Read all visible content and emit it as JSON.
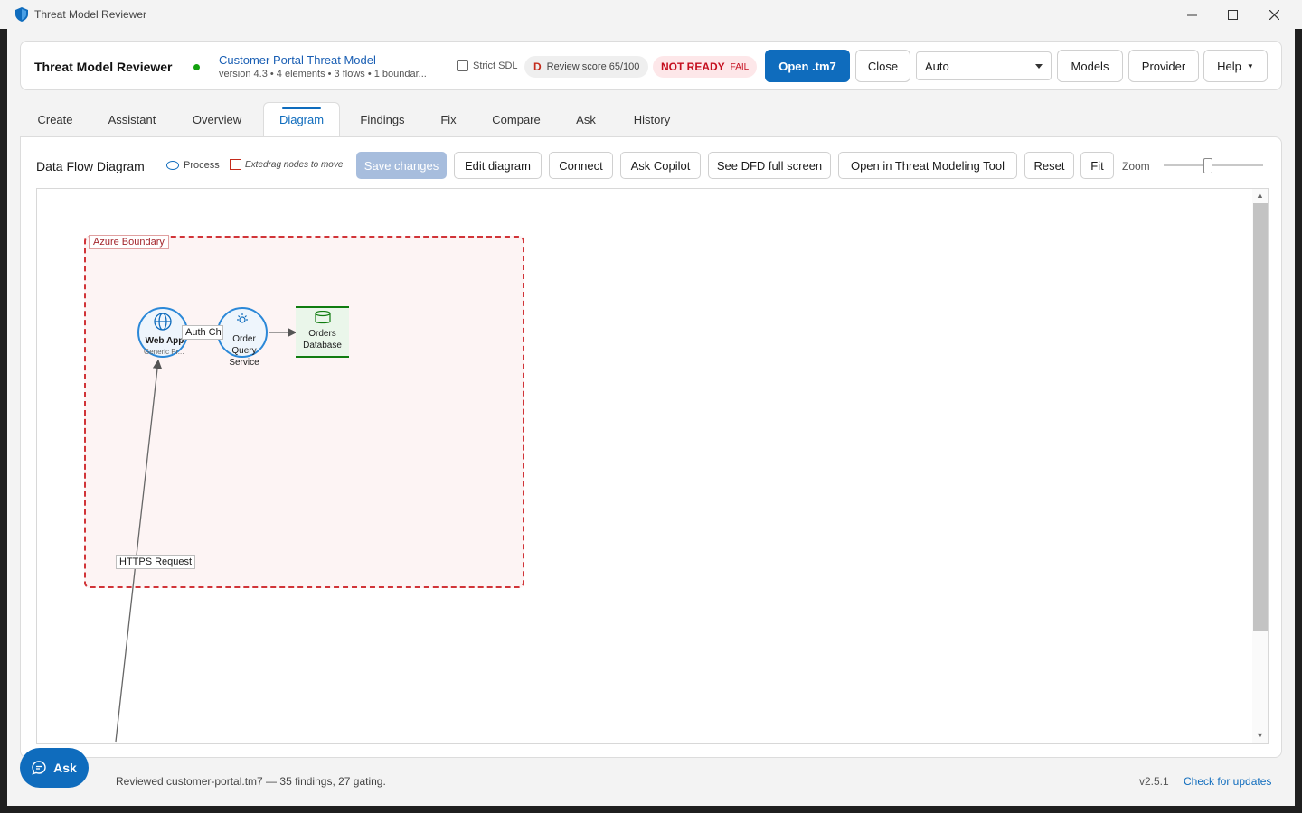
{
  "window": {
    "title": "Threat Model Reviewer"
  },
  "header": {
    "app_name": "Threat Model Reviewer",
    "model_title": "Customer Portal Threat Model",
    "model_meta": "version 4.3  •  4 elements  •  3 flows  •  1 boundar...",
    "strict_sdl_label": "Strict SDL",
    "score_grade": "D",
    "score_text": "Review score 65/100",
    "readiness": "NOT READY",
    "readiness_status": "FAIL",
    "open_label": "Open .tm7",
    "close_label": "Close",
    "provider_select_value": "Auto",
    "models_label": "Models",
    "provider_label": "Provider",
    "help_label": "Help"
  },
  "tabs": [
    {
      "label": "Create"
    },
    {
      "label": "Assistant"
    },
    {
      "label": "Overview"
    },
    {
      "label": "Diagram",
      "active": true
    },
    {
      "label": "Findings"
    },
    {
      "label": "Fix"
    },
    {
      "label": "Compare"
    },
    {
      "label": "Ask"
    },
    {
      "label": "History"
    }
  ],
  "diagram": {
    "title": "Data Flow Diagram",
    "legend_process": "Process",
    "legend_external": "Extedrag nodes to move",
    "buttons": {
      "save": "Save changes",
      "edit": "Edit diagram",
      "connect": "Connect",
      "ask_copilot": "Ask Copilot",
      "full_screen": "See DFD full screen",
      "open_tmt": "Open in Threat Modeling Tool",
      "reset": "Reset",
      "fit": "Fit"
    },
    "zoom_label": "Zoom",
    "zoom_level": 0.45,
    "boundary_label": "Azure Boundary",
    "nodes": {
      "web_app": {
        "label": "Web App",
        "sublabel": "Generic Pr..."
      },
      "order_query": {
        "label": "Order Query Service"
      },
      "orders_db": {
        "label": "Orders Database"
      }
    },
    "flows": {
      "auth": "Auth Ch",
      "https": "HTTPS Request"
    }
  },
  "footer": {
    "ask_label": "Ask",
    "status": "Reviewed customer-portal.tm7 — 35 findings, 27 gating.",
    "version": "v2.5.1",
    "updates_label": "Check for updates"
  },
  "colors": {
    "accent": "#0f6cbd",
    "fail": "#c50f1f",
    "boundary": "#d13438",
    "process": "#2b88d8",
    "store": "#107c10"
  }
}
